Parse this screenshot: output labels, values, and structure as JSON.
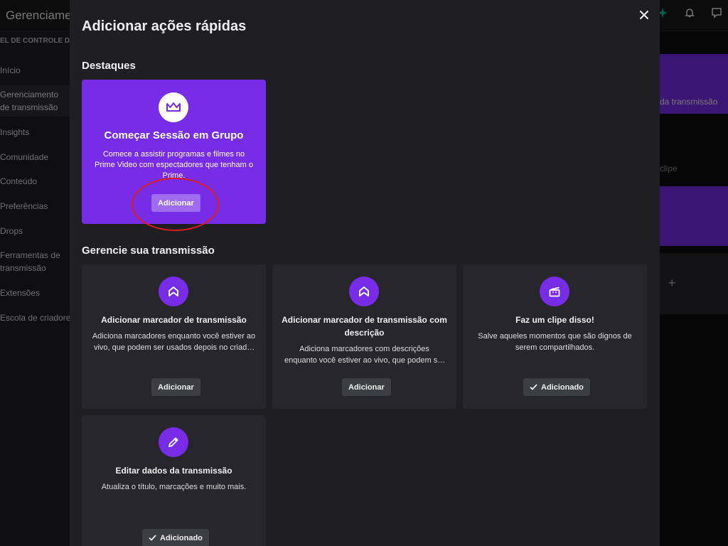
{
  "background": {
    "app_title": "Gerenciamen",
    "sidebar": {
      "header": "EL DE CONTROLE DO DOR",
      "items": [
        {
          "label": "Início"
        },
        {
          "label": "Gerenciamento de transmissão"
        },
        {
          "label": "Insights"
        },
        {
          "label": "Comunidade"
        },
        {
          "label": "Conteúdo"
        },
        {
          "label": "Preferências"
        },
        {
          "label": "Drops"
        },
        {
          "label": "Ferramentas de transmissão"
        },
        {
          "label": "Extensões"
        },
        {
          "label": "Escola de criadores"
        }
      ]
    },
    "right_panel": {
      "text1": "da transmissão",
      "text2": "clipe",
      "plus": "+"
    }
  },
  "modal": {
    "title": "Adicionar ações rápidas",
    "close_label": "✕",
    "highlights_title": "Destaques",
    "featured": {
      "icon": "crown-icon",
      "title": "Começar Sessão em Grupo",
      "description": "Comece a assistir programas e filmes no Prime Video com espectadores que tenham o Prime.",
      "button_label": "Adicionar"
    },
    "manage_title": "Gerencie sua transmissão",
    "cards": [
      {
        "icon": "stream-marker-icon",
        "title": "Adicionar marcador de transmissão",
        "description": "Adiciona marcadores enquanto você estiver ao vivo, que podem ser usados depois no criador de destaques.",
        "button_label": "Adicionar",
        "added": false
      },
      {
        "icon": "stream-marker-icon",
        "title": "Adicionar marcador de transmissão com descrição",
        "description": "Adiciona marcadores com descrições enquanto você estiver ao vivo, que podem ser usados depois.",
        "button_label": "Adicionar",
        "added": false
      },
      {
        "icon": "clapperboard-icon",
        "title": "Faz um clipe disso!",
        "description": "Salve aqueles momentos que são dignos de serem compartilhados.",
        "button_label": "Adicionado",
        "added": true
      },
      {
        "icon": "pencil-icon",
        "title": "Editar dados da transmissão",
        "description": "Atualiza o título, marcações e muito mais.",
        "button_label": "Adicionado",
        "added": true
      }
    ]
  },
  "colors": {
    "accent": "#772ce8",
    "annotation_ring": "#e01b1b"
  }
}
